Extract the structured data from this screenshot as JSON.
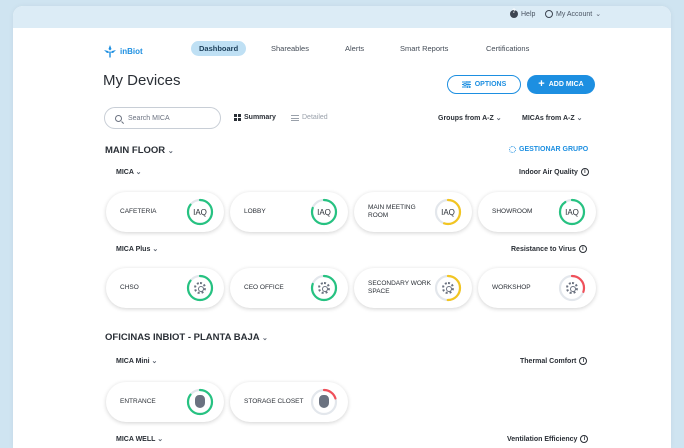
{
  "topbar": {
    "help_label": "Help",
    "account_label": "My Account"
  },
  "brand": {
    "name": "inBiot",
    "color": "#1d8fe1"
  },
  "nav": {
    "tabs": [
      "Dashboard",
      "Shareables",
      "Alerts",
      "Smart Reports",
      "Certifications"
    ],
    "active": "Dashboard"
  },
  "page": {
    "title": "My Devices"
  },
  "toolbar": {
    "options_label": "OPTIONS",
    "add_label": "ADD MICA"
  },
  "filters": {
    "search_placeholder": "Search MICA",
    "summary_label": "Summary",
    "detailed_label": "Detailed",
    "groups_sort": "Groups from A-Z",
    "micas_sort": "MICAs from A-Z"
  },
  "groups": [
    {
      "title": "MAIN FLOOR",
      "action_label": "GESTIONAR GRUPO",
      "sections": [
        {
          "type": "MICA",
          "metric": "Indoor Air Quality",
          "devices": [
            {
              "name": "CAFETERIA",
              "gauge": "IAQ",
              "status": "good",
              "fill": 0.85
            },
            {
              "name": "LOBBY",
              "gauge": "IAQ",
              "status": "good",
              "fill": 0.8
            },
            {
              "name": "MAIN MEETING ROOM",
              "gauge": "IAQ",
              "status": "moderate",
              "fill": 0.55
            },
            {
              "name": "SHOWROOM",
              "gauge": "IAQ",
              "status": "good",
              "fill": 0.9
            }
          ]
        },
        {
          "type": "MICA Plus",
          "metric": "Resistance to Virus",
          "devices": [
            {
              "name": "CHSO",
              "icon": "gear-icon",
              "status": "good",
              "fill": 0.85
            },
            {
              "name": "CEO OFFICE",
              "icon": "gear-icon",
              "status": "good",
              "fill": 0.8
            },
            {
              "name": "SECONDARY WORK SPACE",
              "icon": "gear-icon",
              "status": "moderate",
              "fill": 0.5
            },
            {
              "name": "WORKSHOP",
              "icon": "gear-icon",
              "status": "poor",
              "fill": 0.3
            }
          ]
        }
      ]
    },
    {
      "title": "OFICINAS INBIOT - PLANTA BAJA",
      "sections": [
        {
          "type": "MICA Mini",
          "metric": "Thermal Comfort",
          "devices": [
            {
              "name": "ENTRANCE",
              "icon": "thermometer-icon",
              "status": "good",
              "fill": 0.85
            },
            {
              "name": "STORAGE CLOSET",
              "icon": "thermometer-icon",
              "status": "poor",
              "fill": 0.2
            }
          ]
        },
        {
          "type": "MICA WELL",
          "metric": "Ventilation Efficiency",
          "devices": []
        }
      ]
    }
  ],
  "status_colors": {
    "good": "#26c281",
    "moderate": "#f2c521",
    "poor": "#f0505a",
    "track": "#e3e7ec"
  }
}
